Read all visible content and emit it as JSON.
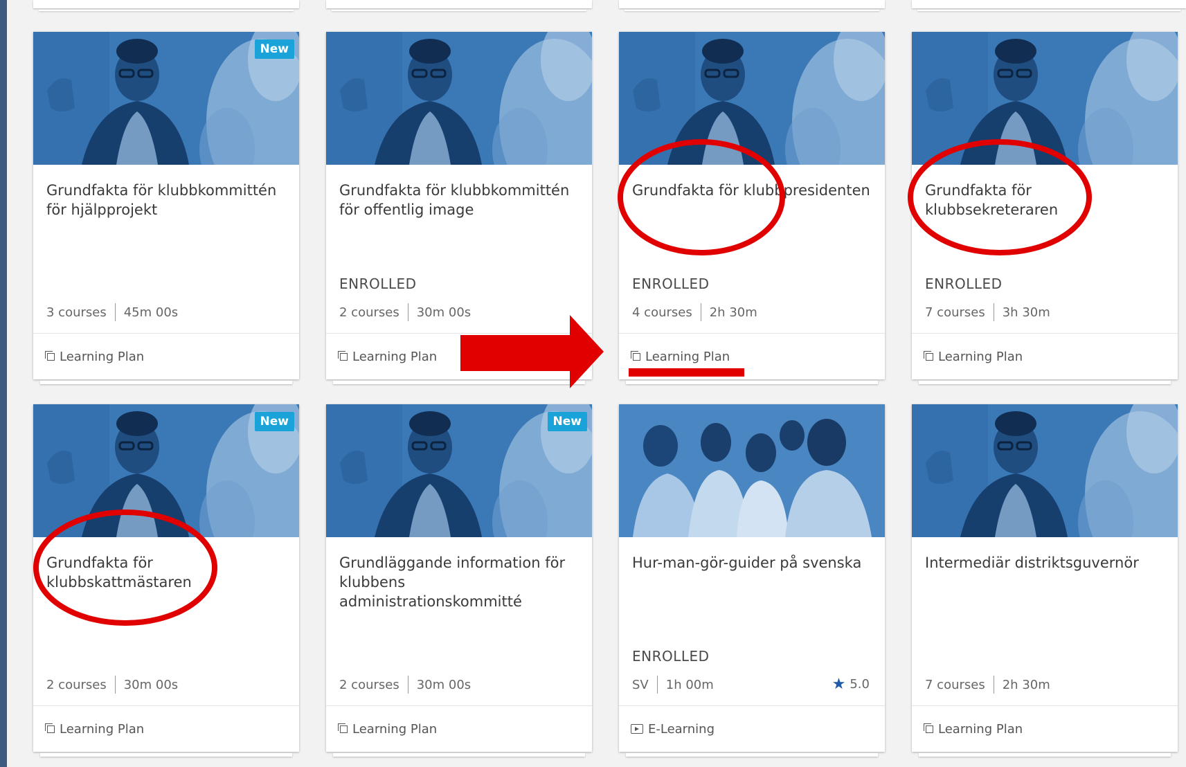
{
  "cards": [
    {
      "title": "Grundfakta för klubbkommittén för hjälpprojekt",
      "badge": "New",
      "status": "",
      "courses": "3 courses",
      "duration": "45m 00s",
      "type": "Learning Plan",
      "icon": "learning-plan-icon",
      "image": "woman-speaking-photo"
    },
    {
      "title": "Grundfakta för klubbkommittén för offentlig image",
      "badge": "",
      "status": "ENROLLED",
      "courses": "2 courses",
      "duration": "30m 00s",
      "type": "Learning Plan",
      "icon": "learning-plan-icon",
      "image": "woman-speaking-photo"
    },
    {
      "title": "Grundfakta för klubbpresidenten",
      "badge": "",
      "status": "ENROLLED",
      "courses": "4 courses",
      "duration": "2h 30m",
      "type": "Learning Plan",
      "icon": "learning-plan-icon",
      "image": "woman-speaking-photo"
    },
    {
      "title": "Grundfakta för klubbsekreteraren",
      "badge": "",
      "status": "ENROLLED",
      "courses": "7 courses",
      "duration": "3h 30m",
      "type": "Learning Plan",
      "icon": "learning-plan-icon",
      "image": "woman-speaking-photo"
    },
    {
      "title": "Grundfakta för klubbskattmästaren",
      "badge": "New",
      "status": "",
      "courses": "2 courses",
      "duration": "30m 00s",
      "type": "Learning Plan",
      "icon": "learning-plan-icon",
      "image": "woman-speaking-photo"
    },
    {
      "title": "Grundläggande information för klubbens administrationskommitté",
      "badge": "New",
      "status": "",
      "courses": "2 courses",
      "duration": "30m 00s",
      "type": "Learning Plan",
      "icon": "learning-plan-icon",
      "image": "woman-speaking-photo"
    },
    {
      "title": "Hur-man-gör-guider på svenska",
      "badge": "",
      "status": "ENROLLED",
      "courses": "SV",
      "duration": "1h 00m",
      "rating": "5.0",
      "type": "E-Learning",
      "icon": "e-learning-icon",
      "image": "group-of-students-photo"
    },
    {
      "title": "Intermediär distriktsguvernör",
      "badge": "",
      "status": "",
      "courses": "7 courses",
      "duration": "2h 30m",
      "type": "Learning Plan",
      "icon": "learning-plan-icon",
      "image": "woman-speaking-photo"
    }
  ],
  "colors": {
    "accent": "#1aa3d8",
    "annotation": "#e00000",
    "thumb": "#2f6aa8"
  }
}
